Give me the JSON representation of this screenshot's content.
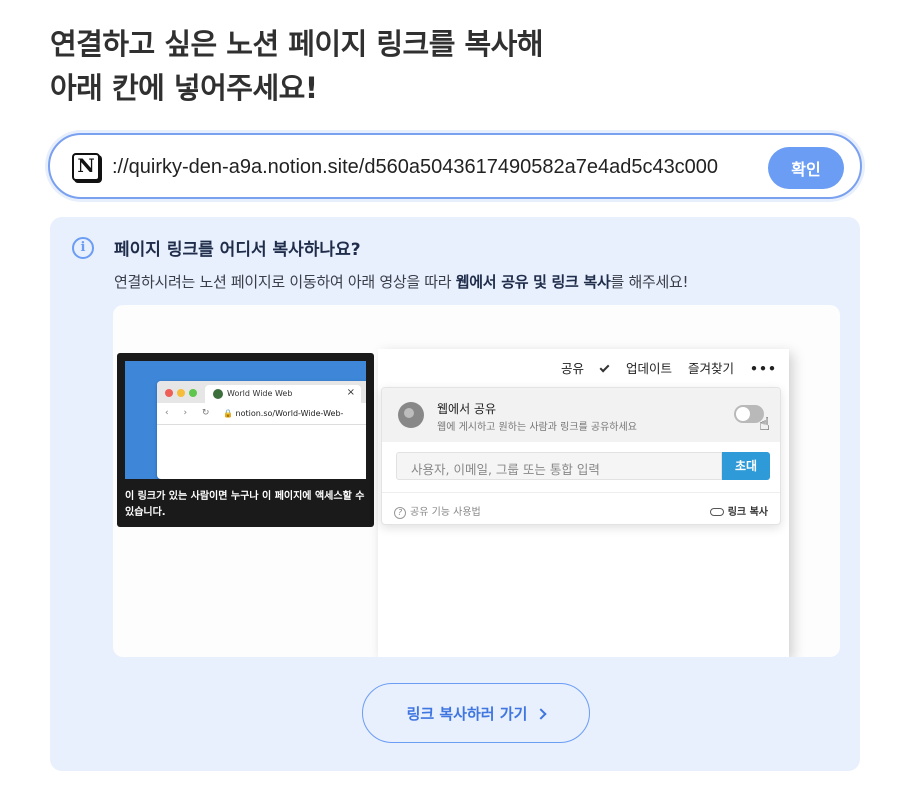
{
  "title_line1": "연결하고 싶은 노션 페이지 링크를 복사해",
  "title_line2": "아래 칸에 넣어주세요!",
  "url_input": {
    "value": "://quirky-den-a9a.notion.site/d560a5043617490582a7e4ad5c43c000",
    "logo_letter": "N"
  },
  "confirm_label": "확인",
  "help": {
    "icon": "info-icon",
    "icon_glyph": "i",
    "title": "페이지 링크를 어디서 복사하나요?",
    "desc_pre": "연결하시려는 노션 페이지로 이동하여 아래 영상을 따라 ",
    "desc_bold": "웹에서 공유 및 링크 복사",
    "desc_post": "를 해주세요!"
  },
  "video": {
    "tooltip": {
      "tab_title": "World Wide Web",
      "tab_close": "×",
      "nav": "‹ › ↻",
      "address": "🔒 notion.so/World-Wide-Web-",
      "caption": "이 링크가 있는 사람이면 누구나 이 페이지에 액세스할 수 있습니다."
    },
    "topbar": {
      "share": "공유",
      "updates": "업데이트",
      "favorites": "즐겨찾기",
      "more": "•••"
    },
    "share_popup": {
      "publish_title": "웹에서 공유",
      "publish_sub": "웹에 게시하고 원하는 사람과 링크를 공유하세요",
      "invite_placeholder": "사용자, 이메일, 그룹 또는 통합 입력",
      "invite_button": "초대",
      "help_link": "공유 기능 사용법",
      "copy_link": "링크 복사"
    }
  },
  "go_button_label": "링크 복사하러 가기",
  "colors": {
    "accent": "#6b9df5",
    "panel_bg": "#e8effd",
    "invite_button": "#2f9ad8"
  }
}
